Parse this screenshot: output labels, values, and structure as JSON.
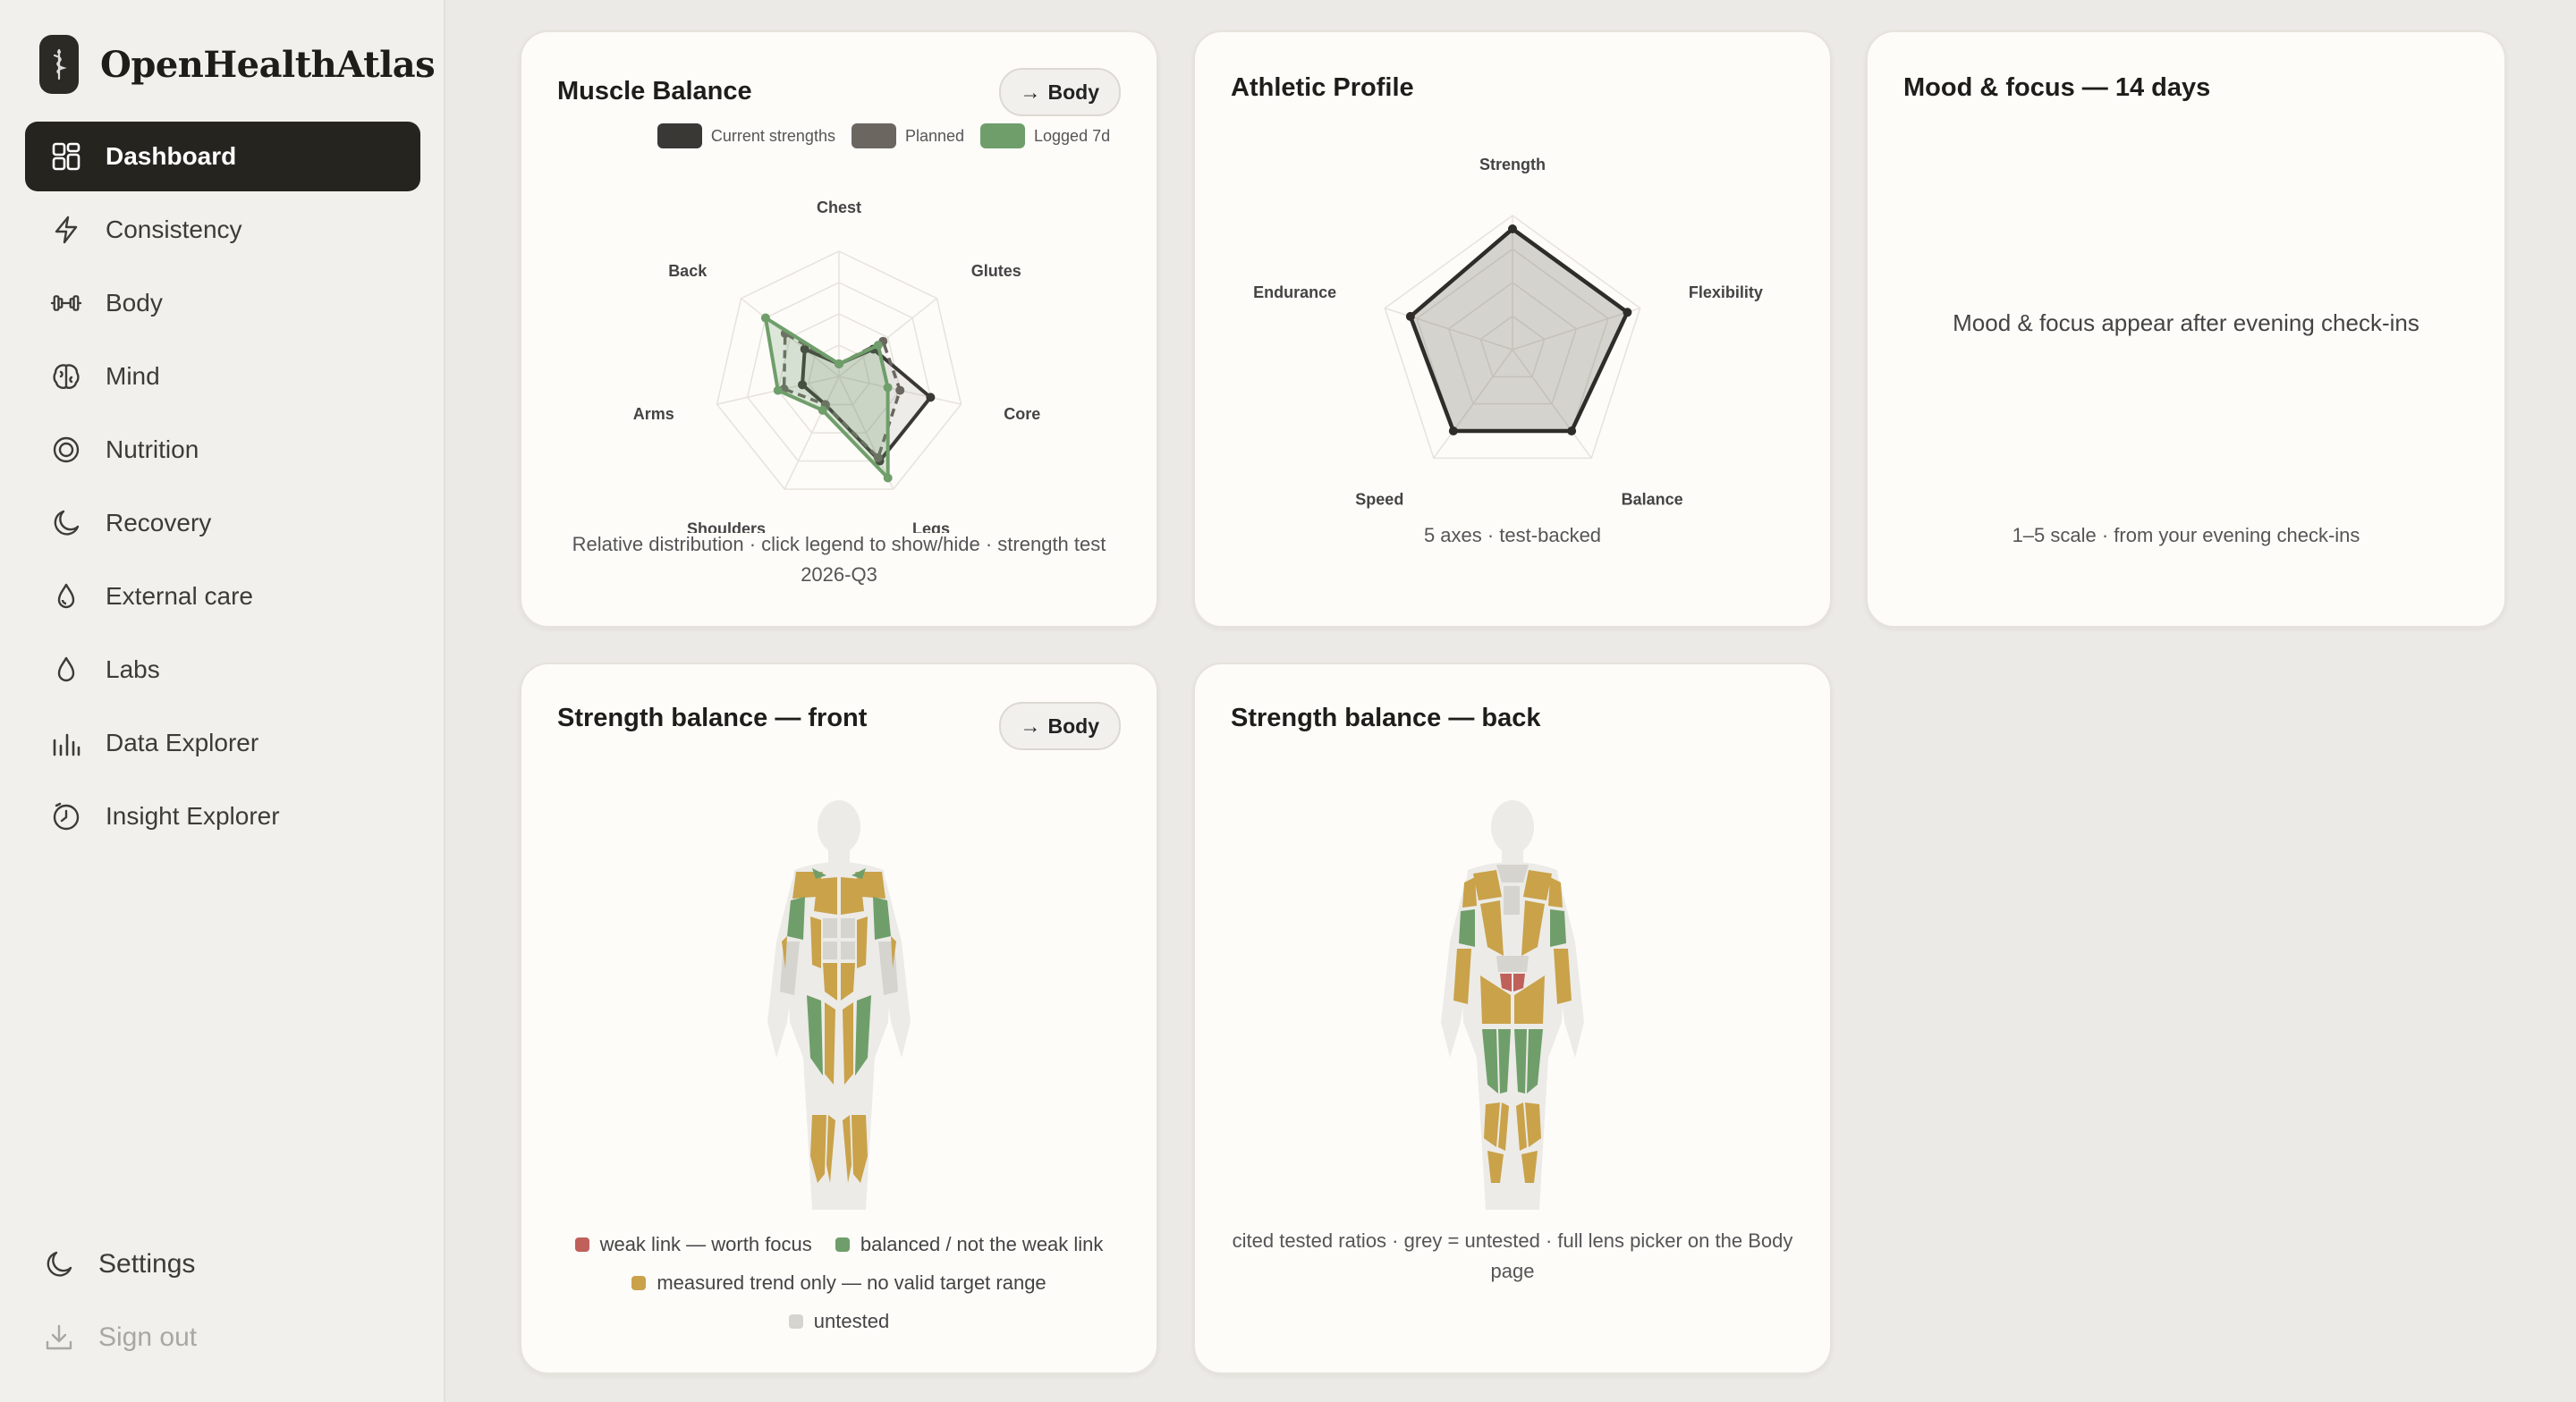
{
  "app": {
    "name": "OpenHealthAtlas"
  },
  "sidebar": {
    "items": [
      {
        "label": "Dashboard",
        "icon": "dashboard-grid-icon",
        "active": true
      },
      {
        "label": "Consistency",
        "icon": "lightning-icon"
      },
      {
        "label": "Body",
        "icon": "dumbbell-icon"
      },
      {
        "label": "Mind",
        "icon": "brain-icon"
      },
      {
        "label": "Nutrition",
        "icon": "target-icon"
      },
      {
        "label": "Recovery",
        "icon": "moon-icon"
      },
      {
        "label": "External care",
        "icon": "drop-icon"
      },
      {
        "label": "Labs",
        "icon": "drop-icon"
      },
      {
        "label": "Data Explorer",
        "icon": "bar-chart-icon"
      },
      {
        "label": "Insight Explorer",
        "icon": "clock-icon"
      }
    ],
    "settings_label": "Settings",
    "signout_label": "Sign out"
  },
  "cards": {
    "muscle_balance": {
      "title": "Muscle Balance",
      "button_label": "Body",
      "legend": [
        "Current strengths",
        "Planned",
        "Logged 7d"
      ],
      "caption": "Relative distribution · click legend to show/hide · strength test 2026-Q3"
    },
    "athletic_profile": {
      "title": "Athletic Profile",
      "caption": "5 axes · test-backed"
    },
    "mood_focus": {
      "title": "Mood & focus — 14 days",
      "empty_message": "Mood & focus appear after evening check-ins",
      "caption": "1–5 scale · from your evening check-ins"
    },
    "strength_front": {
      "title": "Strength balance — front",
      "button_label": "Body",
      "legend": [
        {
          "label": "weak link — worth focus",
          "color": "#c0605a"
        },
        {
          "label": "balanced / not the weak link",
          "color": "#6f9e6a"
        },
        {
          "label": "measured trend only — no valid target range",
          "color": "#c9a24a"
        },
        {
          "label": "untested",
          "color": "#d6d4cf"
        }
      ]
    },
    "strength_back": {
      "title": "Strength balance — back",
      "caption": "cited tested ratios · grey = untested · full lens picker on the Body page"
    }
  },
  "colors": {
    "current": "#3a3835",
    "planned": "#6b6760",
    "logged": "#6f9e6a",
    "weak": "#c0605a",
    "balanced": "#6f9e6a",
    "trend": "#c9a24a",
    "untested": "#d6d4cf"
  },
  "chart_data": [
    {
      "type": "radar",
      "title": "Muscle Balance",
      "axes": [
        "Chest",
        "Glutes",
        "Core",
        "Legs",
        "Shoulders",
        "Arms",
        "Back"
      ],
      "range": [
        0,
        1
      ],
      "series": [
        {
          "name": "Current strengths",
          "values": [
            0.1,
            0.35,
            0.75,
            0.75,
            0.25,
            0.3,
            0.35
          ],
          "style": "solid"
        },
        {
          "name": "Planned",
          "values": [
            0.1,
            0.45,
            0.5,
            0.72,
            0.25,
            0.45,
            0.55
          ],
          "style": "dashed"
        },
        {
          "name": "Logged 7d",
          "values": [
            0.1,
            0.4,
            0.4,
            0.9,
            0.3,
            0.5,
            0.75
          ],
          "style": "solid"
        }
      ]
    },
    {
      "type": "radar",
      "title": "Athletic Profile",
      "axes": [
        "Strength",
        "Flexibility",
        "Balance",
        "Speed",
        "Endurance"
      ],
      "range": [
        0,
        1
      ],
      "series": [
        {
          "name": "Profile",
          "values": [
            0.9,
            0.9,
            0.75,
            0.75,
            0.8
          ]
        }
      ]
    }
  ]
}
